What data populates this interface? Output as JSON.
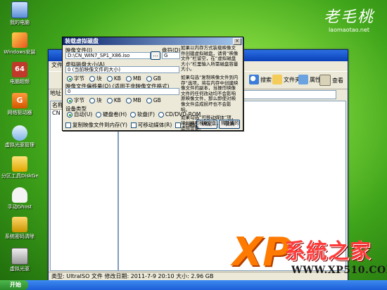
{
  "desktop": {
    "icons": [
      {
        "label": "我的电脑"
      },
      {
        "label": "Windows安装"
      },
      {
        "label": "电脑超频"
      },
      {
        "label": "网络驱动器"
      },
      {
        "label": "虚拟光驱管理"
      },
      {
        "label": "分区工具DiskGenius"
      },
      {
        "label": "手动Ghost"
      },
      {
        "label": "系统密码清除"
      },
      {
        "label": "虚拟光驱"
      }
    ]
  },
  "brand": {
    "name": "老毛桃",
    "url": "laomaotao.net"
  },
  "explorer": {
    "menu_label": "文件",
    "toolbar": {
      "search": "搜索",
      "folders": "文件夹",
      "properties": "属性",
      "view": "查看"
    },
    "address_label": "地址",
    "left_label": "名称",
    "left_item": "CN",
    "status": "类型: UltraISO 文件 修改日期: 2011-7-9 20:10 大小: 2.96 GB"
  },
  "dialog": {
    "title": "装载虚拟磁盘",
    "close": "×",
    "image_file_label": "映像文件(I)",
    "image_file_value": "D:\\CN_WIN7_SP1_X86.iso",
    "browse_label": "...",
    "drive_label": "盘符(D)",
    "drive_value": "G",
    "vdisk_size_label": "虚拟磁盘大小(A)",
    "vdisk_size_value": "0 (当前映像文件的大小)",
    "offset_label": "映像文件偏移量(O) (适用于非映像文件格式)",
    "offset_value": "0",
    "units": [
      "字节",
      "块",
      "KB",
      "MB",
      "GB"
    ],
    "device_type_label": "设备类型",
    "device_types": [
      "自动(U)",
      "硬盘卷(H)",
      "软盘(F)",
      "CD/DVD-ROM"
    ],
    "copy_to_mem": "复制映像文件到内存(Y)",
    "removable": "可移动媒体(R)",
    "readonly": "只读媒体(L)",
    "ok": "确定",
    "cancel": "取消",
    "notes": [
      "如果以内存方式装载映像文件创建虚拟磁盘，请将“映像文件”栏留空，在“虚拟磁盘大小”栏里输入所需磁盘容量大小。",
      "如果勾选“复制映像文件到内存”选项，将在内存中创建映像文件的副本，当操作映像文件的任何改动均不会影响原映像文件，那么即使对映像文件造成损坏也不会影响。",
      "如果勾选“可移动媒体”项，将创建可移动U盘，热插拔的虚拟设备。"
    ]
  },
  "taskbar": {
    "start": "开始"
  },
  "logo": {
    "xp": "XP",
    "name": "系統之家",
    "url": "WWW.XP510.COM"
  },
  "colors": {
    "accent": "#ff7a00",
    "dialog_title": "#0a246a",
    "desktop": "#4aa81f"
  }
}
